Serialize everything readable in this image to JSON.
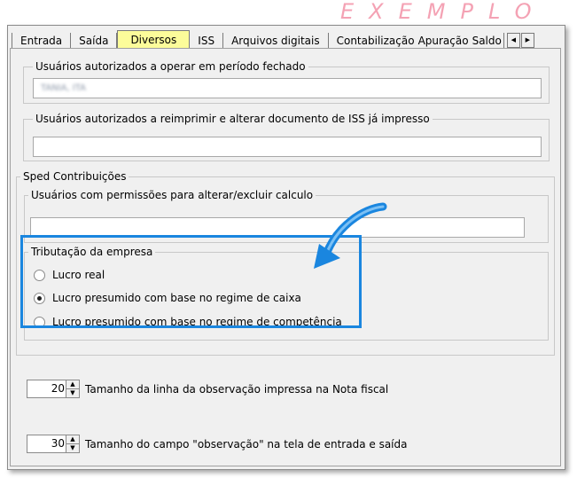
{
  "watermark": "EXEMPLO",
  "tabs": [
    "Entrada",
    "Saída",
    "Diversos",
    "ISS",
    "Arquivos digitais",
    "Contabilização",
    "Apuração",
    "Saldo"
  ],
  "tab_nav": {
    "prev_icon": "◀",
    "next_icon": "▶"
  },
  "groups": {
    "closed_period": {
      "legend": "Usuários autorizados a operar em período fechado",
      "value": "TANIA, ITA"
    },
    "reprint_iss": {
      "legend": "Usuários autorizados a reimprimir e alterar documento de ISS já impresso",
      "value": ""
    },
    "sped": {
      "legend": "Sped Contribuições",
      "calc_permissions": {
        "legend": "Usuários com permissões para alterar/excluir calculo",
        "value": ""
      },
      "taxation": {
        "legend": "Tributação da empresa",
        "options": [
          {
            "label": "Lucro real",
            "checked": false
          },
          {
            "label": "Lucro presumido com base no regime de caixa",
            "checked": true
          },
          {
            "label": "Lucro presumido com base no regime de competência",
            "checked": false
          }
        ]
      }
    }
  },
  "spinners": [
    {
      "value": "20",
      "label": "Tamanho da linha da observação impressa na Nota fiscal"
    },
    {
      "value": "30",
      "label": "Tamanho do campo \"observação\" na tela de entrada e saída"
    }
  ],
  "spin_icons": {
    "up": "▲",
    "down": "▼"
  },
  "colors": {
    "active_tab": "#fcfc9a",
    "highlight": "#1a86df",
    "watermark": "#f4a2b4"
  }
}
